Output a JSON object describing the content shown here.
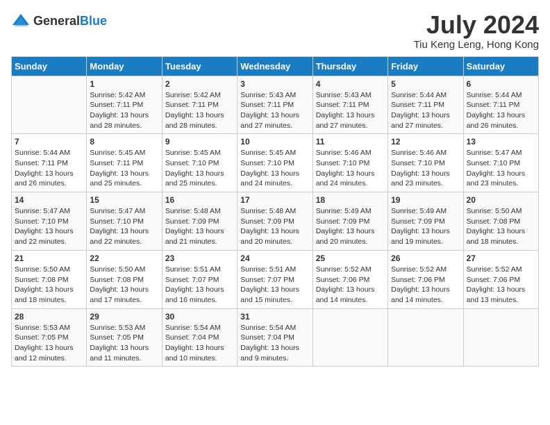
{
  "header": {
    "logo_general": "General",
    "logo_blue": "Blue",
    "month_year": "July 2024",
    "location": "Tiu Keng Leng, Hong Kong"
  },
  "calendar": {
    "days_of_week": [
      "Sunday",
      "Monday",
      "Tuesday",
      "Wednesday",
      "Thursday",
      "Friday",
      "Saturday"
    ],
    "weeks": [
      [
        {
          "day": "",
          "sunrise": "",
          "sunset": "",
          "daylight": ""
        },
        {
          "day": "1",
          "sunrise": "Sunrise: 5:42 AM",
          "sunset": "Sunset: 7:11 PM",
          "daylight": "Daylight: 13 hours and 28 minutes."
        },
        {
          "day": "2",
          "sunrise": "Sunrise: 5:42 AM",
          "sunset": "Sunset: 7:11 PM",
          "daylight": "Daylight: 13 hours and 28 minutes."
        },
        {
          "day": "3",
          "sunrise": "Sunrise: 5:43 AM",
          "sunset": "Sunset: 7:11 PM",
          "daylight": "Daylight: 13 hours and 27 minutes."
        },
        {
          "day": "4",
          "sunrise": "Sunrise: 5:43 AM",
          "sunset": "Sunset: 7:11 PM",
          "daylight": "Daylight: 13 hours and 27 minutes."
        },
        {
          "day": "5",
          "sunrise": "Sunrise: 5:44 AM",
          "sunset": "Sunset: 7:11 PM",
          "daylight": "Daylight: 13 hours and 27 minutes."
        },
        {
          "day": "6",
          "sunrise": "Sunrise: 5:44 AM",
          "sunset": "Sunset: 7:11 PM",
          "daylight": "Daylight: 13 hours and 26 minutes."
        }
      ],
      [
        {
          "day": "7",
          "sunrise": "Sunrise: 5:44 AM",
          "sunset": "Sunset: 7:11 PM",
          "daylight": "Daylight: 13 hours and 26 minutes."
        },
        {
          "day": "8",
          "sunrise": "Sunrise: 5:45 AM",
          "sunset": "Sunset: 7:11 PM",
          "daylight": "Daylight: 13 hours and 25 minutes."
        },
        {
          "day": "9",
          "sunrise": "Sunrise: 5:45 AM",
          "sunset": "Sunset: 7:10 PM",
          "daylight": "Daylight: 13 hours and 25 minutes."
        },
        {
          "day": "10",
          "sunrise": "Sunrise: 5:45 AM",
          "sunset": "Sunset: 7:10 PM",
          "daylight": "Daylight: 13 hours and 24 minutes."
        },
        {
          "day": "11",
          "sunrise": "Sunrise: 5:46 AM",
          "sunset": "Sunset: 7:10 PM",
          "daylight": "Daylight: 13 hours and 24 minutes."
        },
        {
          "day": "12",
          "sunrise": "Sunrise: 5:46 AM",
          "sunset": "Sunset: 7:10 PM",
          "daylight": "Daylight: 13 hours and 23 minutes."
        },
        {
          "day": "13",
          "sunrise": "Sunrise: 5:47 AM",
          "sunset": "Sunset: 7:10 PM",
          "daylight": "Daylight: 13 hours and 23 minutes."
        }
      ],
      [
        {
          "day": "14",
          "sunrise": "Sunrise: 5:47 AM",
          "sunset": "Sunset: 7:10 PM",
          "daylight": "Daylight: 13 hours and 22 minutes."
        },
        {
          "day": "15",
          "sunrise": "Sunrise: 5:47 AM",
          "sunset": "Sunset: 7:10 PM",
          "daylight": "Daylight: 13 hours and 22 minutes."
        },
        {
          "day": "16",
          "sunrise": "Sunrise: 5:48 AM",
          "sunset": "Sunset: 7:09 PM",
          "daylight": "Daylight: 13 hours and 21 minutes."
        },
        {
          "day": "17",
          "sunrise": "Sunrise: 5:48 AM",
          "sunset": "Sunset: 7:09 PM",
          "daylight": "Daylight: 13 hours and 20 minutes."
        },
        {
          "day": "18",
          "sunrise": "Sunrise: 5:49 AM",
          "sunset": "Sunset: 7:09 PM",
          "daylight": "Daylight: 13 hours and 20 minutes."
        },
        {
          "day": "19",
          "sunrise": "Sunrise: 5:49 AM",
          "sunset": "Sunset: 7:09 PM",
          "daylight": "Daylight: 13 hours and 19 minutes."
        },
        {
          "day": "20",
          "sunrise": "Sunrise: 5:50 AM",
          "sunset": "Sunset: 7:08 PM",
          "daylight": "Daylight: 13 hours and 18 minutes."
        }
      ],
      [
        {
          "day": "21",
          "sunrise": "Sunrise: 5:50 AM",
          "sunset": "Sunset: 7:08 PM",
          "daylight": "Daylight: 13 hours and 18 minutes."
        },
        {
          "day": "22",
          "sunrise": "Sunrise: 5:50 AM",
          "sunset": "Sunset: 7:08 PM",
          "daylight": "Daylight: 13 hours and 17 minutes."
        },
        {
          "day": "23",
          "sunrise": "Sunrise: 5:51 AM",
          "sunset": "Sunset: 7:07 PM",
          "daylight": "Daylight: 13 hours and 16 minutes."
        },
        {
          "day": "24",
          "sunrise": "Sunrise: 5:51 AM",
          "sunset": "Sunset: 7:07 PM",
          "daylight": "Daylight: 13 hours and 15 minutes."
        },
        {
          "day": "25",
          "sunrise": "Sunrise: 5:52 AM",
          "sunset": "Sunset: 7:06 PM",
          "daylight": "Daylight: 13 hours and 14 minutes."
        },
        {
          "day": "26",
          "sunrise": "Sunrise: 5:52 AM",
          "sunset": "Sunset: 7:06 PM",
          "daylight": "Daylight: 13 hours and 14 minutes."
        },
        {
          "day": "27",
          "sunrise": "Sunrise: 5:52 AM",
          "sunset": "Sunset: 7:06 PM",
          "daylight": "Daylight: 13 hours and 13 minutes."
        }
      ],
      [
        {
          "day": "28",
          "sunrise": "Sunrise: 5:53 AM",
          "sunset": "Sunset: 7:05 PM",
          "daylight": "Daylight: 13 hours and 12 minutes."
        },
        {
          "day": "29",
          "sunrise": "Sunrise: 5:53 AM",
          "sunset": "Sunset: 7:05 PM",
          "daylight": "Daylight: 13 hours and 11 minutes."
        },
        {
          "day": "30",
          "sunrise": "Sunrise: 5:54 AM",
          "sunset": "Sunset: 7:04 PM",
          "daylight": "Daylight: 13 hours and 10 minutes."
        },
        {
          "day": "31",
          "sunrise": "Sunrise: 5:54 AM",
          "sunset": "Sunset: 7:04 PM",
          "daylight": "Daylight: 13 hours and 9 minutes."
        },
        {
          "day": "",
          "sunrise": "",
          "sunset": "",
          "daylight": ""
        },
        {
          "day": "",
          "sunrise": "",
          "sunset": "",
          "daylight": ""
        },
        {
          "day": "",
          "sunrise": "",
          "sunset": "",
          "daylight": ""
        }
      ]
    ]
  }
}
